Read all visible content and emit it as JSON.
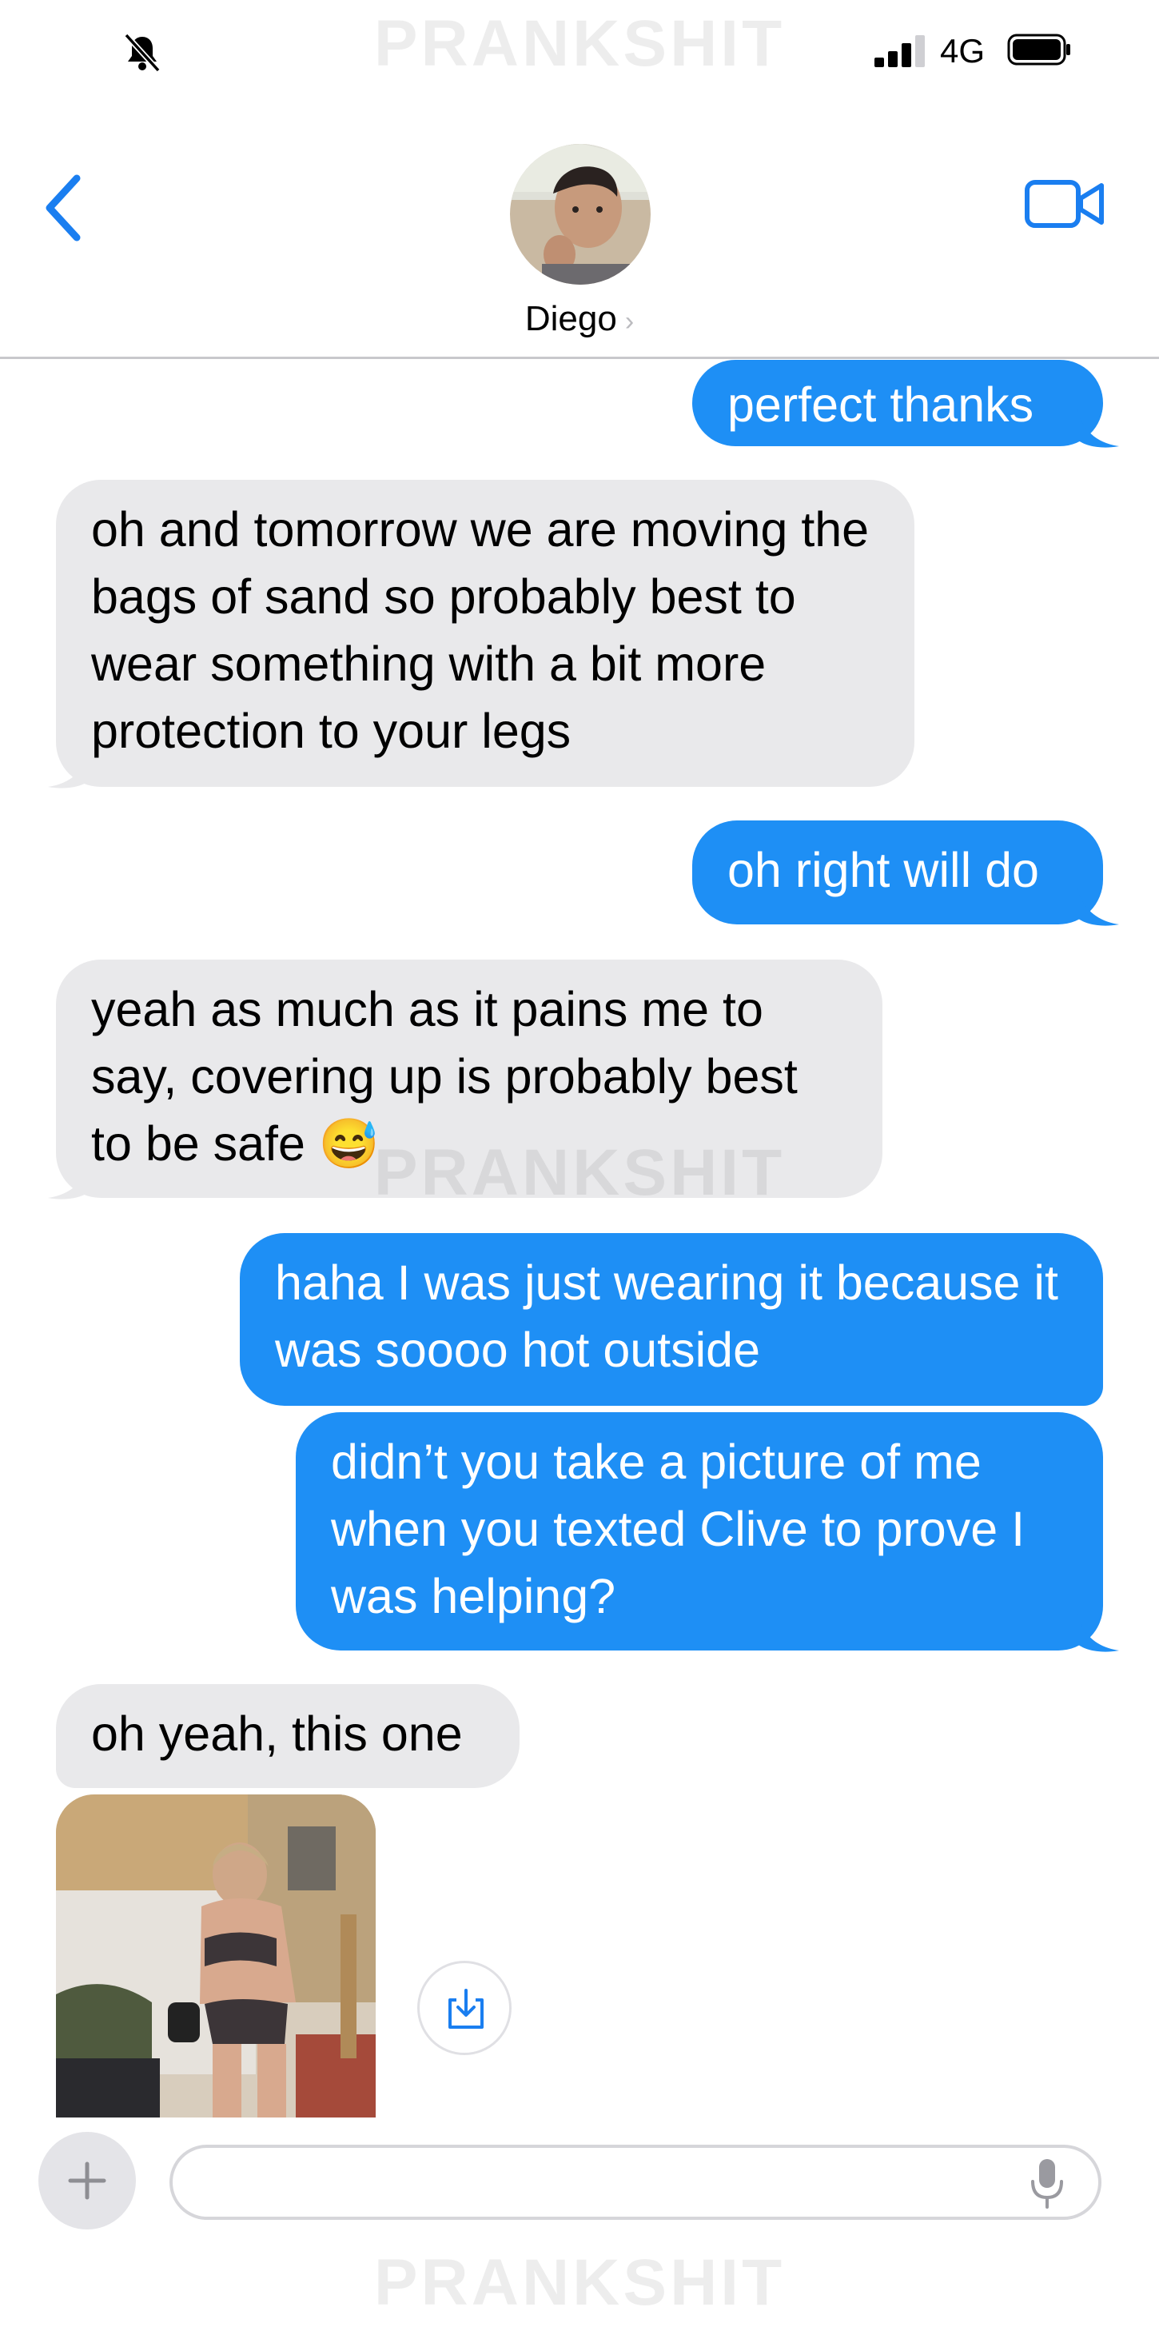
{
  "status_bar": {
    "network": "4G"
  },
  "header": {
    "contact_name": "Diego"
  },
  "watermark": "PRANKSHIT",
  "colors": {
    "outgoing": "#1e8ff5",
    "incoming": "#e9e9eb",
    "accent": "#1a7ef0"
  },
  "messages": [
    {
      "direction": "out",
      "text": "perfect thanks"
    },
    {
      "direction": "in",
      "text": "oh and tomorrow we are moving the bags of sand so probably best to wear something with a bit more protection to your legs"
    },
    {
      "direction": "out",
      "text": "oh right will do"
    },
    {
      "direction": "in",
      "text": "yeah as much as it pains me to say, covering up is probably best to be safe",
      "emoji": "😅"
    },
    {
      "direction": "out",
      "text": "haha I was just wearing it because it was soooo hot outside"
    },
    {
      "direction": "out",
      "text": "didn’t you take a picture of me when you texted Clive to prove I was helping?"
    },
    {
      "direction": "in",
      "text": "oh yeah, this one"
    }
  ],
  "attachment": {
    "type": "photo",
    "save_icon": "download-icon"
  },
  "composer": {
    "input_value": "",
    "plus_icon": "plus-icon",
    "mic_icon": "microphone-icon"
  }
}
